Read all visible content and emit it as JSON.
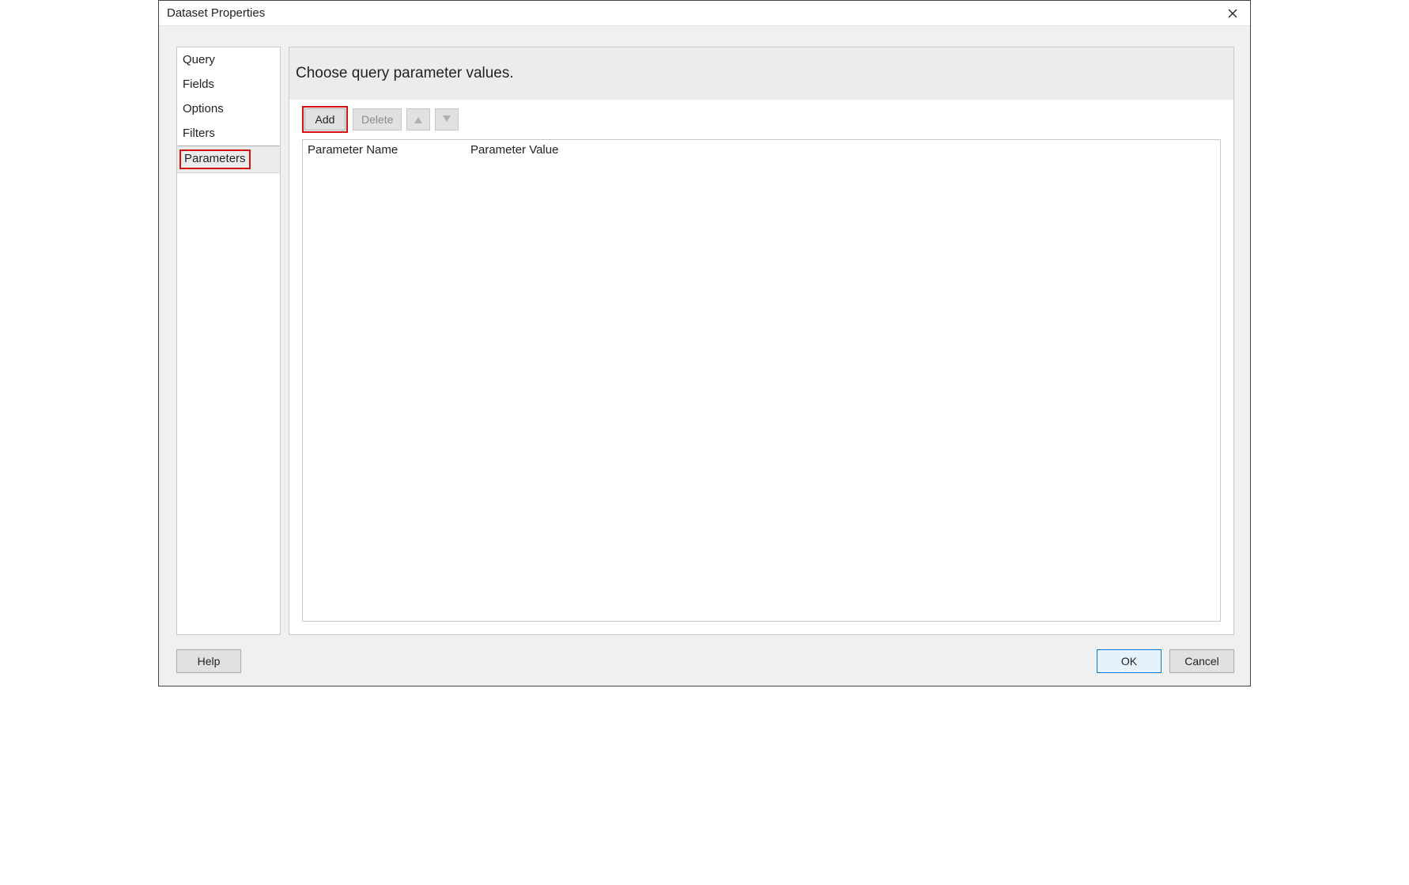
{
  "window": {
    "title": "Dataset Properties"
  },
  "nav": {
    "items": [
      {
        "label": "Query"
      },
      {
        "label": "Fields"
      },
      {
        "label": "Options"
      },
      {
        "label": "Filters"
      },
      {
        "label": "Parameters",
        "selected": true,
        "highlighted": true
      }
    ]
  },
  "content": {
    "heading": "Choose query parameter values.",
    "toolbar": {
      "add_label": "Add",
      "delete_label": "Delete"
    },
    "grid": {
      "columns": {
        "name": "Parameter Name",
        "value": "Parameter Value"
      },
      "rows": []
    }
  },
  "footer": {
    "help_label": "Help",
    "ok_label": "OK",
    "cancel_label": "Cancel"
  }
}
